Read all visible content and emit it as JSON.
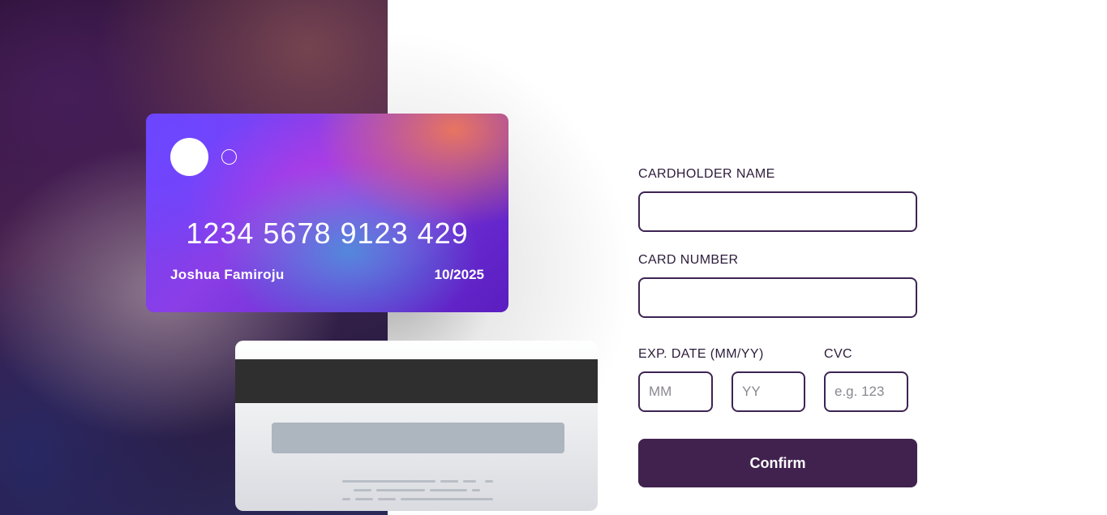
{
  "card_front": {
    "number": "1234 5678 9123 429",
    "holder_name": "Joshua Famiroju",
    "expiry": "10/2025"
  },
  "form": {
    "name_label": "CARDHOLDER NAME",
    "name_value": "",
    "number_label": "CARD NUMBER",
    "number_value": "",
    "exp_label": "EXP. DATE (MM/YY)",
    "mm_placeholder": "MM",
    "yy_placeholder": "YY",
    "cvc_label": "CVC",
    "cvc_placeholder": "e.g. 123",
    "confirm_label": "Confirm"
  },
  "colors": {
    "accent": "#41224f",
    "input_border": "#3d2452",
    "label_text": "#2c1c3a"
  }
}
